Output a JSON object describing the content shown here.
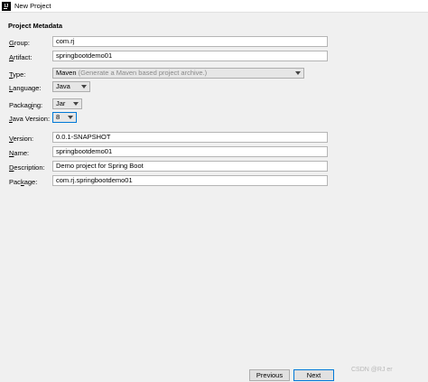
{
  "window": {
    "title": "New Project",
    "icon": "intellij-icon",
    "icon_text": "IJ"
  },
  "section": {
    "title": "Project Metadata"
  },
  "fields": {
    "group": {
      "label_key": "G",
      "label_rest": "roup:",
      "value": "com.rj"
    },
    "artifact": {
      "label_key": "A",
      "label_rest": "rtifact:",
      "value": "springbootdemo01"
    },
    "type": {
      "label_key": "T",
      "label_rest": "ype:",
      "value": "Maven",
      "hint": "(Generate a Maven based project archive.)"
    },
    "language": {
      "label_key": "L",
      "label_rest": "anguage:",
      "value": "Java"
    },
    "packaging": {
      "label_pre": "Packag",
      "label_key": "i",
      "label_rest": "ng:",
      "value": "Jar"
    },
    "java_version": {
      "label_key": "J",
      "label_rest": "ava Version:",
      "value": "8"
    },
    "version": {
      "label_key": "V",
      "label_rest": "ersion:",
      "value": "0.0.1-SNAPSHOT"
    },
    "name": {
      "label_key": "N",
      "label_rest": "ame:",
      "value": "springbootdemo01"
    },
    "description": {
      "label_key": "D",
      "label_rest": "escription:",
      "value": "Demo project for Spring Boot"
    },
    "package": {
      "label_pre": "Pac",
      "label_key": "k",
      "label_rest": "age:",
      "value": "com.rj.springbootdemo01"
    }
  },
  "buttons": {
    "previous": "Previous",
    "next": "Next"
  },
  "watermark": "CSDN @RJ   er"
}
